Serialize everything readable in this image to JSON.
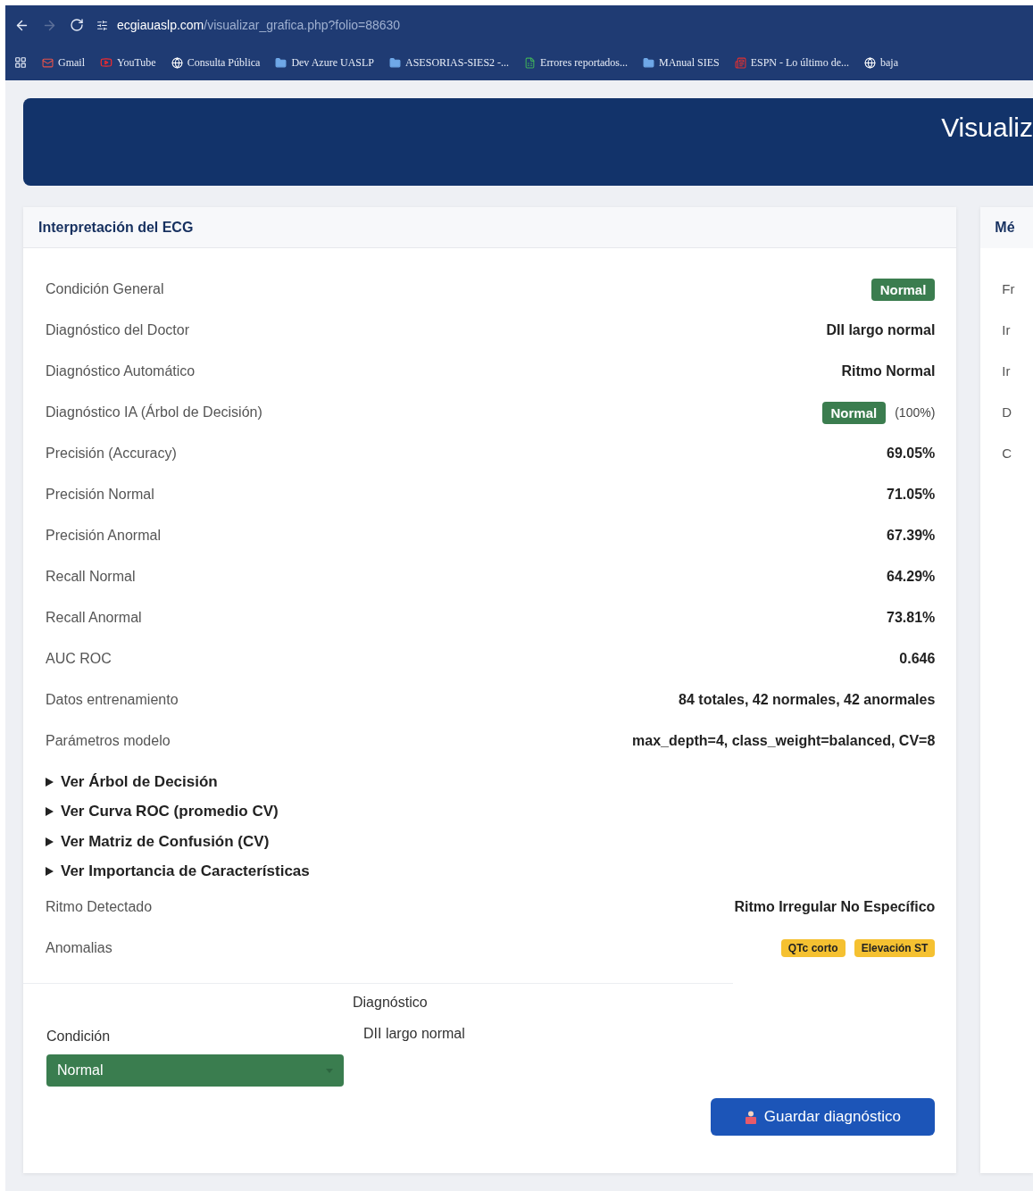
{
  "browser": {
    "url_domain": "ecgiauaslp.com",
    "url_path": "/visualizar_grafica.php?folio=88630",
    "forward_disabled": true,
    "bookmarks": [
      {
        "label": "Gmail",
        "kind": "mail"
      },
      {
        "label": "YouTube",
        "kind": "video"
      },
      {
        "label": "Consulta Pública",
        "kind": "globe"
      },
      {
        "label": "Dev Azure UASLP",
        "kind": "folder"
      },
      {
        "label": "ASESORIAS-SIES2 -...",
        "kind": "folder"
      },
      {
        "label": "Errores reportados...",
        "kind": "sheet"
      },
      {
        "label": "MAnual SIES",
        "kind": "folder"
      },
      {
        "label": "ESPN - Lo último de...",
        "kind": "news"
      },
      {
        "label": "baja",
        "kind": "globe"
      }
    ]
  },
  "header": {
    "title": "Visualiz"
  },
  "card": {
    "title": "Interpretación del ECG",
    "rows": [
      {
        "label": "Condición General",
        "kind": "badge",
        "value": "Normal"
      },
      {
        "label": "Diagnóstico del Doctor",
        "kind": "text",
        "value": "DII largo normal"
      },
      {
        "label": "Diagnóstico Automático",
        "kind": "text",
        "value": "Ritmo Normal"
      },
      {
        "label": "Diagnóstico IA (Árbol de Decisión)",
        "kind": "badge",
        "value": "Normal",
        "note": "(100%)"
      },
      {
        "label": "Precisión (Accuracy)",
        "kind": "text",
        "value": "69.05%"
      },
      {
        "label": "Precisión Normal",
        "kind": "text",
        "value": "71.05%"
      },
      {
        "label": "Precisión Anormal",
        "kind": "text",
        "value": "67.39%"
      },
      {
        "label": "Recall Normal",
        "kind": "text",
        "value": "64.29%"
      },
      {
        "label": "Recall Anormal",
        "kind": "text",
        "value": "73.81%"
      },
      {
        "label": "AUC ROC",
        "kind": "text",
        "value": "0.646"
      },
      {
        "label": "Datos entrenamiento",
        "kind": "text",
        "value": "84 totales, 42 normales, 42 anormales"
      },
      {
        "label": "Parámetros modelo",
        "kind": "text",
        "value": "max_depth=4, class_weight=balanced, CV=8"
      }
    ],
    "sections": [
      {
        "label": "Ver Árbol de Decisión",
        "expanded": false
      },
      {
        "label": "Ver Curva ROC (promedio CV)",
        "expanded": false
      },
      {
        "label": "Ver Matriz de Confusión (CV)",
        "expanded": false
      },
      {
        "label": "Ver Importancia de Características",
        "expanded": false
      }
    ],
    "rows_after": [
      {
        "label": "Ritmo Detectado",
        "kind": "text",
        "value": "Ritmo Irregular No Específico"
      },
      {
        "label": "Anomalias",
        "kind": "tags",
        "tags": [
          "QTc corto",
          "Elevación ST"
        ]
      }
    ],
    "form": {
      "condition_label": "Condición",
      "condition_value": "Normal",
      "diagnosis_label": "Diagnóstico",
      "diagnosis_value": "DII largo normal",
      "save_button": "Guardar diagnóstico"
    }
  },
  "side_card": {
    "title": "Mé",
    "items": [
      "Fr",
      "Ir",
      "Ir",
      "D",
      "C"
    ]
  }
}
